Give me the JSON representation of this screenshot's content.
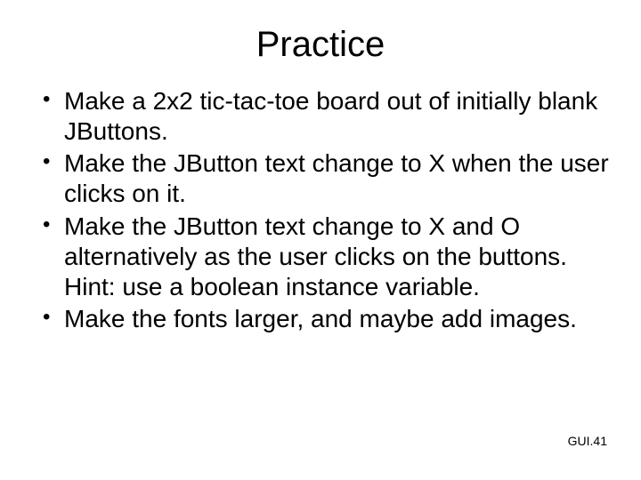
{
  "slide": {
    "title": "Practice",
    "bullets": [
      "Make a 2x2 tic-tac-toe board out of initially blank JButtons.",
      "Make the JButton text change to X when the user clicks on it.",
      "Make the JButton text change to X and O alternatively as the user clicks on the buttons.\nHint: use a boolean instance variable.",
      "Make the fonts larger, and maybe add images."
    ],
    "footer": "GUI.41"
  }
}
